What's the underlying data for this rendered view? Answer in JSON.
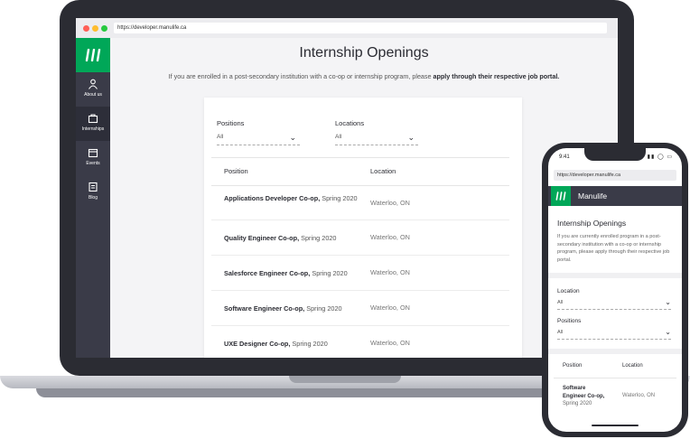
{
  "laptop": {
    "url": "https://developer.manulife.ca",
    "traffic_lights": [
      "#ff5f56",
      "#ffbd2e",
      "#27c93f"
    ],
    "sidebar": {
      "brand_color": "#00a758",
      "items": [
        {
          "label": "About us",
          "icon": "person-icon"
        },
        {
          "label": "Internships",
          "icon": "briefcase-icon"
        },
        {
          "label": "Events",
          "icon": "calendar-icon"
        },
        {
          "label": "Blog",
          "icon": "document-icon"
        }
      ]
    },
    "page": {
      "title": "Internship Openings",
      "intro_text": "If you are enrolled in a post-secondary institution with a co-op or internship program, please ",
      "intro_bold": "apply through their respective job portal."
    },
    "filters": {
      "positions_label": "Positions",
      "positions_value": "All",
      "locations_label": "Locations",
      "locations_value": "All"
    },
    "table": {
      "headers": [
        "Position",
        "Location"
      ],
      "rows": [
        {
          "title": "Applications Developer Co-op,",
          "term": " Spring 2020",
          "location": "Waterloo, ON"
        },
        {
          "title": "Quality Engineer Co-op,",
          "term": " Spring 2020",
          "location": "Waterloo, ON"
        },
        {
          "title": "Salesforce Engineer Co-op,",
          "term": " Spring 2020",
          "location": "Waterloo, ON"
        },
        {
          "title": "Software Engineer Co-op,",
          "term": " Spring 2020",
          "location": "Waterloo, ON"
        },
        {
          "title": "UXE Designer Co-op,",
          "term": " Spring 2020",
          "location": "Waterloo, ON"
        }
      ]
    }
  },
  "phone": {
    "time": "9:41",
    "url": "https://developer.manulife.ca",
    "brand": "Manulife",
    "title": "Internship Openings",
    "intro": "If you are currently enrolled program in a post-secondary institution with a co-op or internship program, please apply through their respective job portal.",
    "location_label": "Location",
    "location_value": "All",
    "positions_label": "Positions",
    "positions_value": "All",
    "headers": [
      "Position",
      "Location"
    ],
    "row": {
      "title_line1": "Software",
      "title_line2": "Engineer Co-op,",
      "term": "Spring 2020",
      "location": "Waterloo, ON"
    }
  }
}
